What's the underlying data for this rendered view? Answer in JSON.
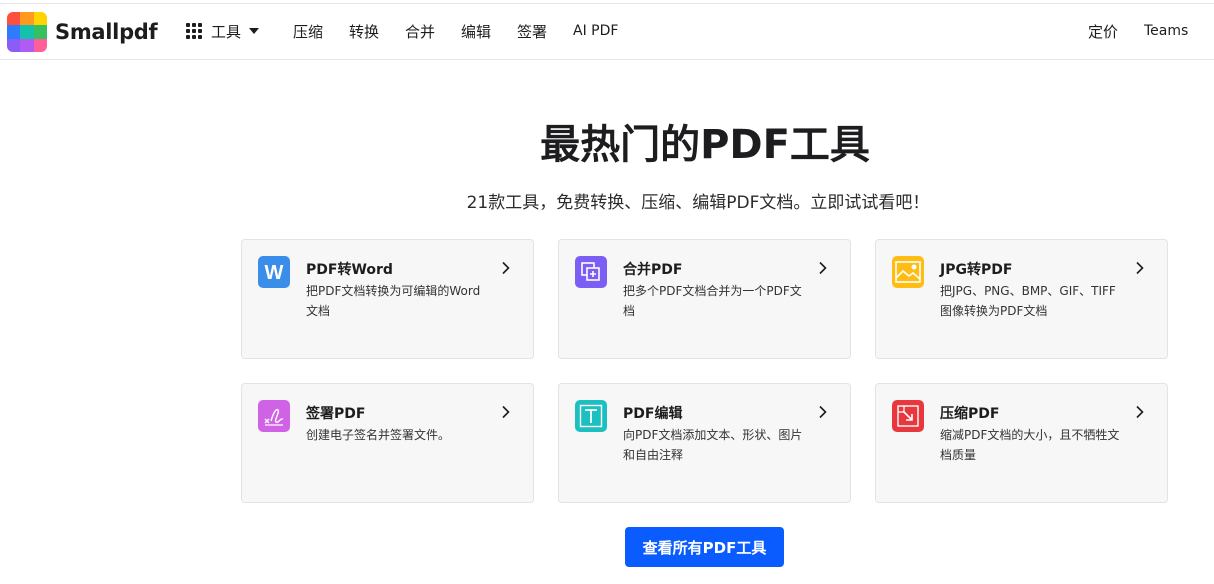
{
  "brand": {
    "name": "Smallpdf",
    "logo_colors": [
      "#ff4f3f",
      "#ffb800",
      "#ffd400",
      "#2e7bff",
      "#14c1a9",
      "#37c05f",
      "#8b5cf6",
      "#d957f2",
      "#ff5e9a"
    ]
  },
  "nav": {
    "tools_label": "工具",
    "links": [
      "压缩",
      "转换",
      "合并",
      "编辑",
      "签署",
      "AI PDF"
    ],
    "right_links": [
      "定价",
      "Teams"
    ]
  },
  "hero": {
    "title": "最热门的PDF工具",
    "subtitle": "21款工具，免费转换、压缩、编辑PDF文档。立即试试看吧！"
  },
  "tools": [
    {
      "title": "PDF转Word",
      "desc": "把PDF文档转换为可编辑的Word文档",
      "icon": "word-icon",
      "color": "#3b8dea"
    },
    {
      "title": "合并PDF",
      "desc": "把多个PDF文档合并为一个PDF文档",
      "icon": "merge-icon",
      "color": "#7b5ef3"
    },
    {
      "title": "JPG转PDF",
      "desc": "把JPG、PNG、BMP、GIF、TIFF图像转换为PDF文档",
      "icon": "image-icon",
      "color": "#ffbd14"
    },
    {
      "title": "签署PDF",
      "desc": "创建电子签名并签署文件。",
      "icon": "signature-icon",
      "color": "#d062e6"
    },
    {
      "title": "PDF编辑",
      "desc": "向PDF文档添加文本、形状、图片和自由注释",
      "icon": "text-edit-icon",
      "color": "#1cc0c0"
    },
    {
      "title": "压缩PDF",
      "desc": "缩减PDF文档的大小，且不牺牲文档质量",
      "icon": "compress-icon",
      "color": "#e8383d"
    }
  ],
  "cta": {
    "label": "查看所有PDF工具",
    "color": "#0a5cff"
  }
}
